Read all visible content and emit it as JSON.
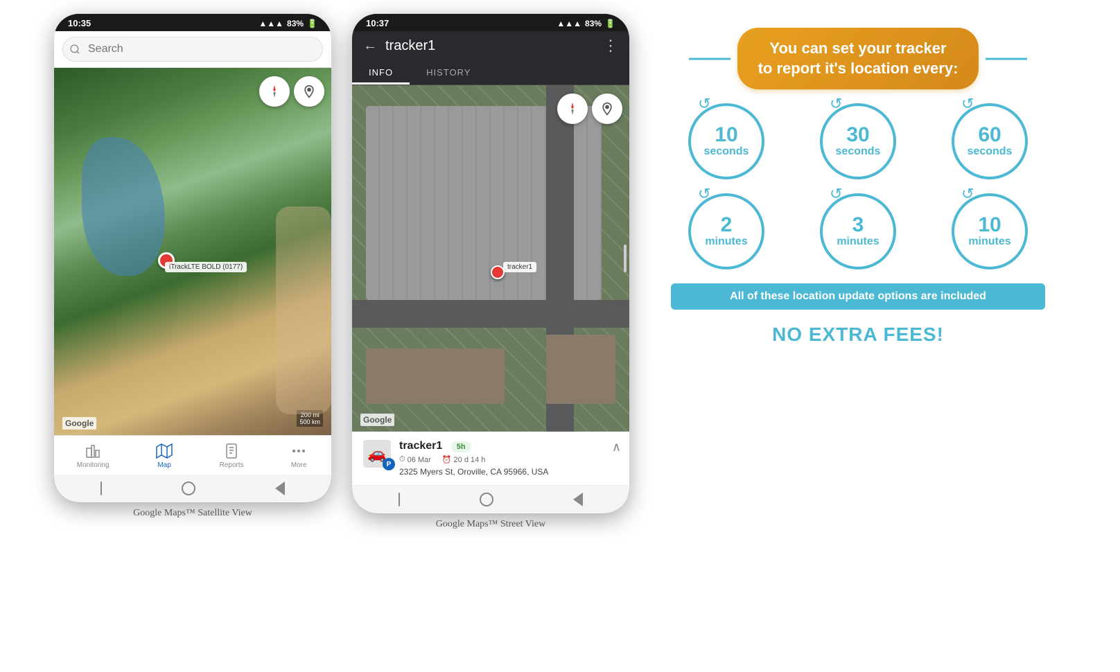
{
  "phone1": {
    "status_time": "10:35",
    "status_signal": "📶",
    "status_battery": "83%",
    "search_placeholder": "Search",
    "map_type": "satellite",
    "tracker_label": "iTrackLTE BOLD (0177)",
    "google_logo": "Google",
    "scale_text": "200 mi\n500 km",
    "nav_items": [
      {
        "label": "Monitoring",
        "active": false
      },
      {
        "label": "Map",
        "active": true
      },
      {
        "label": "Reports",
        "active": false
      },
      {
        "label": "More",
        "active": false
      }
    ],
    "caption": "Google Maps™ Satellite View"
  },
  "phone2": {
    "status_time": "10:37",
    "status_signal": "📶",
    "status_battery": "83%",
    "header_title": "tracker1",
    "tabs": [
      {
        "label": "INFO",
        "active": true
      },
      {
        "label": "HISTORY",
        "active": false
      }
    ],
    "google_logo": "Google",
    "tracker_name": "tracker1",
    "tracker_date": "06 Mar",
    "tracker_duration": "20 d 14 h",
    "tracker_address": "2325 Myers St, Oroville, CA 95966, USA",
    "tracker_time_badge": "5h",
    "caption": "Google Maps™ Street View"
  },
  "infographic": {
    "header_line1": "You can set your tracker",
    "header_line2": "to report it's location every:",
    "circles": [
      {
        "number": "10",
        "unit": "seconds"
      },
      {
        "number": "30",
        "unit": "seconds"
      },
      {
        "number": "60",
        "unit": "seconds"
      },
      {
        "number": "2",
        "unit": "minutes"
      },
      {
        "number": "3",
        "unit": "minutes"
      },
      {
        "number": "10",
        "unit": "minutes"
      }
    ],
    "banner_text": "All of these location update options are included",
    "no_fees_text": "NO EXTRA FEES!"
  }
}
